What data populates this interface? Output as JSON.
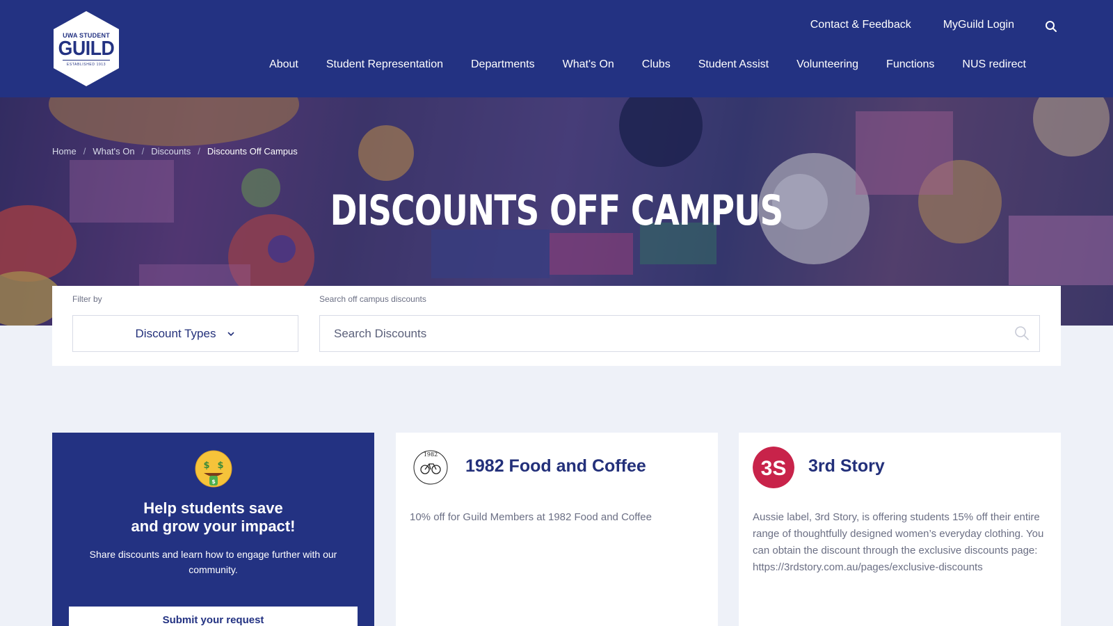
{
  "logo": {
    "line1": "UWA STUDENT",
    "line2": "GUILD",
    "line3": "ESTABLISHED 1913"
  },
  "utility_nav": {
    "contact": "Contact & Feedback",
    "login": "MyGuild Login",
    "search_icon": "search-icon"
  },
  "main_nav": [
    {
      "label": "About"
    },
    {
      "label": "Student Representation"
    },
    {
      "label": "Departments"
    },
    {
      "label": "What's On"
    },
    {
      "label": "Clubs"
    },
    {
      "label": "Student Assist"
    },
    {
      "label": "Volunteering"
    },
    {
      "label": "Functions"
    },
    {
      "label": "NUS redirect"
    }
  ],
  "breadcrumb": {
    "items": [
      "Home",
      "What's On",
      "Discounts"
    ],
    "separator": "/",
    "current": "Discounts Off Campus"
  },
  "hero": {
    "title": "DISCOUNTS OFF CAMPUS"
  },
  "filter": {
    "filter_label": "Filter by",
    "dropdown_value": "Discount Types",
    "search_label": "Search off campus discounts",
    "search_placeholder": "Search Discounts"
  },
  "promo": {
    "emoji": "money-mouth-face",
    "title_line1": "Help students save",
    "title_line2": "and grow your impact!",
    "text": "Share discounts and learn how to engage further with our community.",
    "button": "Submit your request"
  },
  "cards": [
    {
      "title": "1982 Food and Coffee",
      "logo_text": "1982",
      "description": "10% off for Guild Members at 1982 Food and Coffee"
    },
    {
      "title": "3rd Story",
      "logo_text": "3S",
      "description": "Aussie label, 3rd Story, is offering students 15% off their entire range of thoughtfully designed women’s everyday clothing. You can obtain the discount through the exclusive discounts page: https://3rdstory.com.au/pages/exclusive-discounts"
    }
  ],
  "colors": {
    "brand_navy": "#233282",
    "background": "#eef1f8",
    "card": "#ffffff",
    "three_s_red": "#c8234a"
  }
}
